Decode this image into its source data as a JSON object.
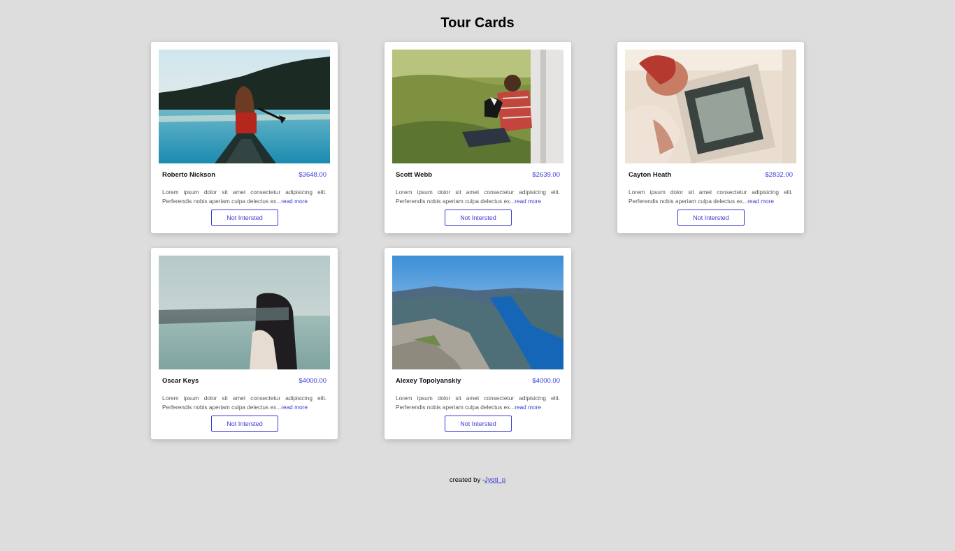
{
  "page": {
    "title": "Tour Cards"
  },
  "tours": [
    {
      "name": "Roberto Nickson",
      "price": "$3648.00",
      "description": "Lorem ipsum dolor sit amet consectetur adipisicing elit. Perferendis nobis aperiam culpa delectus ex...",
      "read_more": "read more",
      "button": "Not Intersted",
      "image": "woman-in-canoe-on-lake"
    },
    {
      "name": "Scott Webb",
      "price": "$2639.00",
      "description": "Lorem ipsum dolor sit amet consectetur adipisicing elit. Perferendis nobis aperiam culpa delectus ex...",
      "read_more": "read more",
      "button": "Not Intersted",
      "image": "man-with-dog-in-grass"
    },
    {
      "name": "Cayton Heath",
      "price": "$2832.00",
      "description": "Lorem ipsum dolor sit amet consectetur adipisicing elit. Perferendis nobis aperiam culpa delectus ex...",
      "read_more": "read more",
      "button": "Not Intersted",
      "image": "couple-in-van-window"
    },
    {
      "name": "Oscar Keys",
      "price": "$4000.00",
      "description": "Lorem ipsum dolor sit amet consectetur adipisicing elit. Perferendis nobis aperiam culpa delectus ex...",
      "read_more": "read more",
      "button": "Not Intersted",
      "image": "blindfolded-woman-by-sea"
    },
    {
      "name": "Alexey Topolyanskiy",
      "price": "$4000.00",
      "description": "Lorem ipsum dolor sit amet consectetur adipisicing elit. Perferendis nobis aperiam culpa delectus ex...",
      "read_more": "read more",
      "button": "Not Intersted",
      "image": "fjord-from-cliff"
    }
  ],
  "footer": {
    "prefix": "created by -",
    "author": "Jyoti_p"
  },
  "colors": {
    "accent": "#3a3ad6",
    "background": "#dddddd",
    "card": "#ffffff"
  }
}
